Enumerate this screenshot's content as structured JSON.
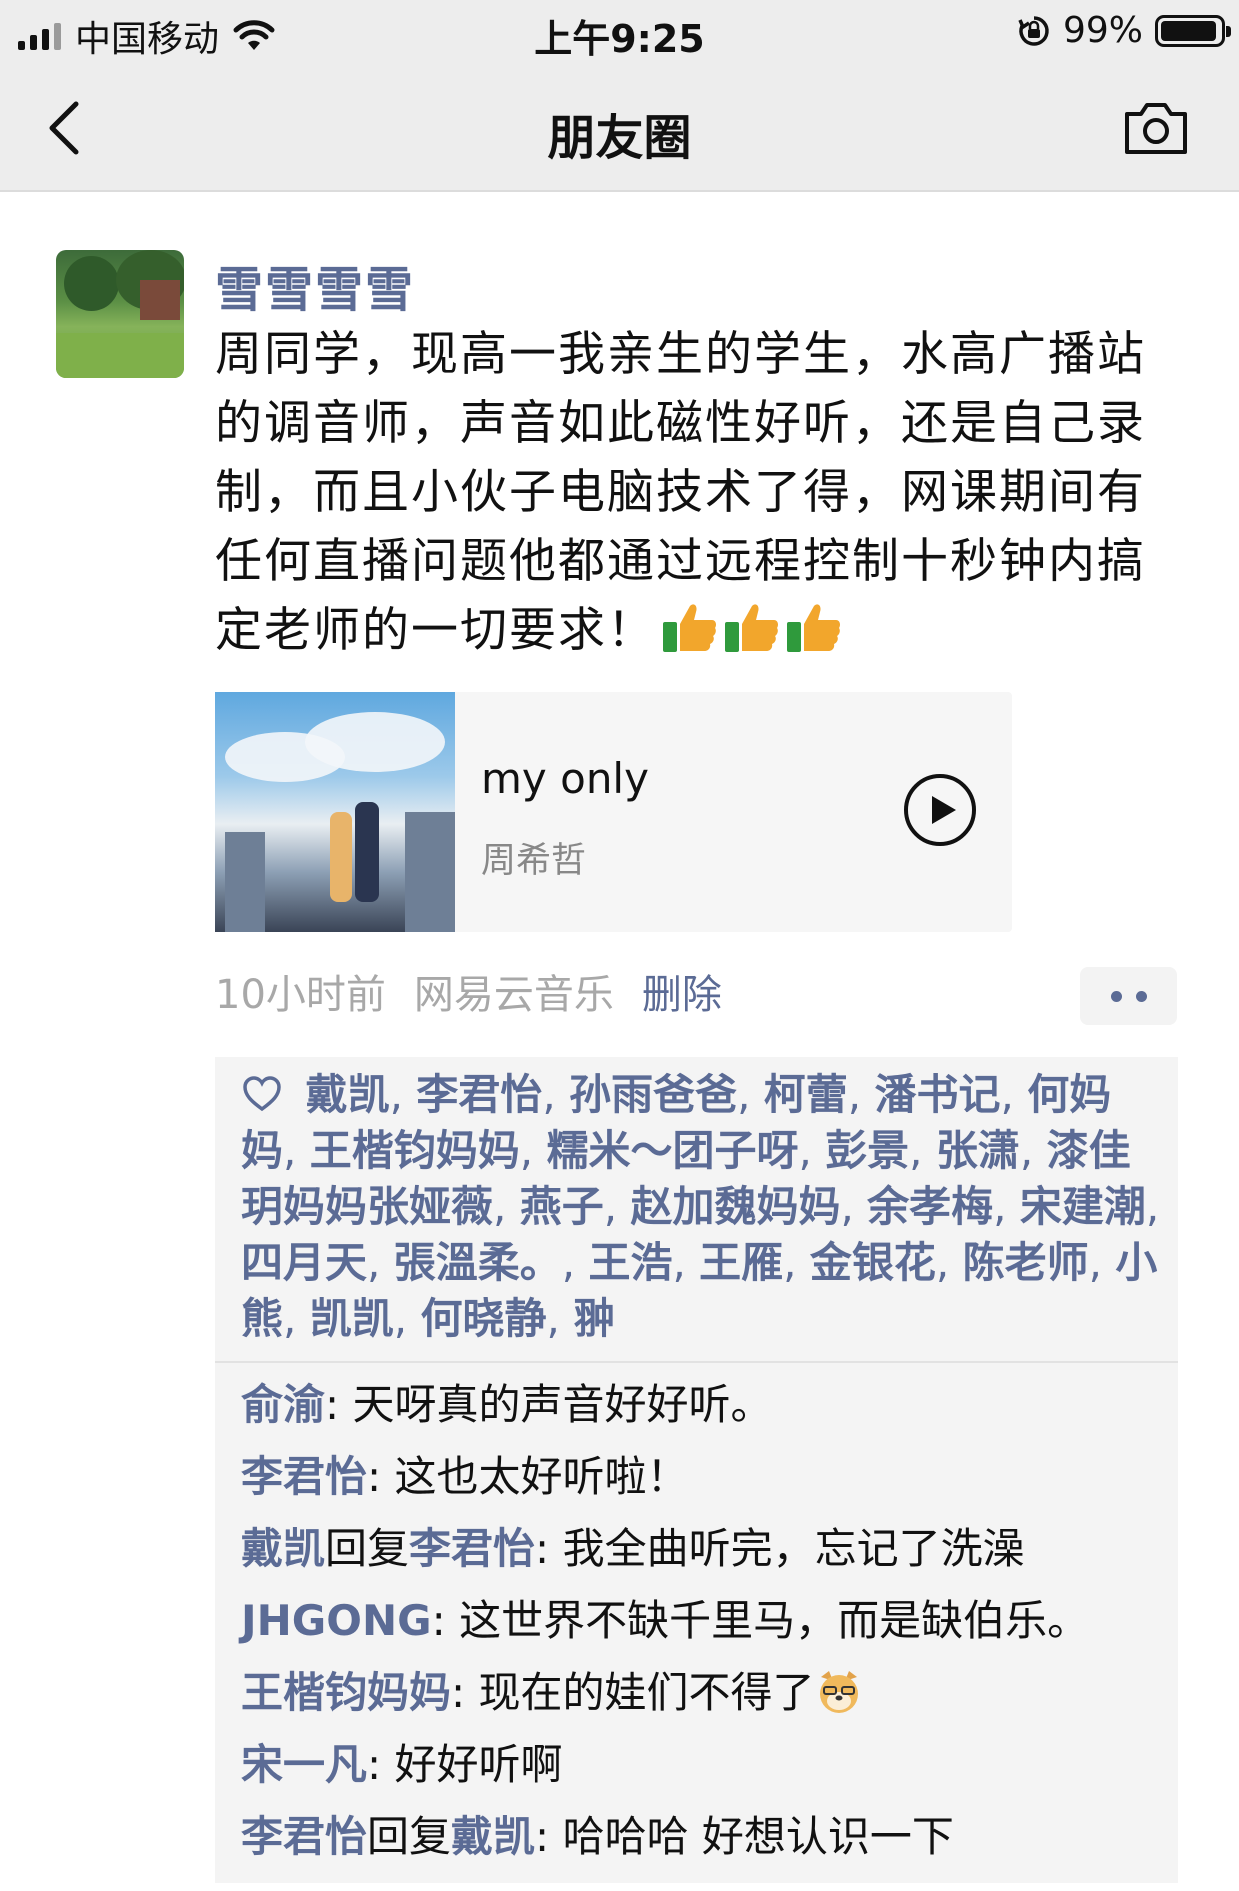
{
  "status_bar": {
    "carrier": "中国移动",
    "time": "上午9:25",
    "battery_percent": "99%",
    "battery_level": 0.99
  },
  "nav": {
    "title": "朋友圈",
    "back_icon": "chevron-left-icon",
    "camera_icon": "camera-icon"
  },
  "post": {
    "username": "雪雪雪雪",
    "text": "周同学，现高一我亲生的学生，水高广播站的调音师，声音如此磁性好听，还是自己录制，而且小伙子电脑技术了得，网课期间有任何直播问题他都通过远程控制十秒钟内搞定老师的一切要求！",
    "emoji": "thumbs-up-icon",
    "music": {
      "title": "my only",
      "artist": "周希哲",
      "play_icon": "play-circle-icon"
    },
    "time_ago": "10小时前",
    "source": "网易云音乐",
    "delete_label": "删除"
  },
  "likes": [
    "戴凯",
    "李君怡",
    "孙雨爸爸",
    "柯蕾",
    "潘书记",
    "何妈妈",
    "王楷钧妈妈",
    "糯米～团子呀",
    "彭景",
    "张潇",
    "漆佳玥妈妈张娅薇",
    "燕子",
    "赵加魏妈妈",
    "余孝梅",
    "宋建潮",
    "四月天",
    "張溫柔。",
    "王浩",
    "王雁",
    "金银花",
    "陈老师",
    "小熊",
    "凯凯",
    "何晓静",
    "翀"
  ],
  "comments": [
    {
      "name": "俞渝",
      "text": "天呀真的声音好好听。"
    },
    {
      "name": "李君怡",
      "text": "这也太好听啦！"
    },
    {
      "name": "戴凯",
      "reply_word": "回复",
      "reply_to": "李君怡",
      "text": "我全曲听完，忘记了洗澡"
    },
    {
      "name": "JHGONG",
      "text": "这世界不缺千里马，而是缺伯乐。"
    },
    {
      "name": "王楷钧妈妈",
      "text": "现在的娃们不得了",
      "emoji": "doge-icon"
    },
    {
      "name": "宋一凡",
      "text": "好好听啊"
    },
    {
      "name": "李君怡",
      "reply_word": "回复",
      "reply_to": "戴凯",
      "text": "哈哈哈 好想认识一下"
    }
  ]
}
